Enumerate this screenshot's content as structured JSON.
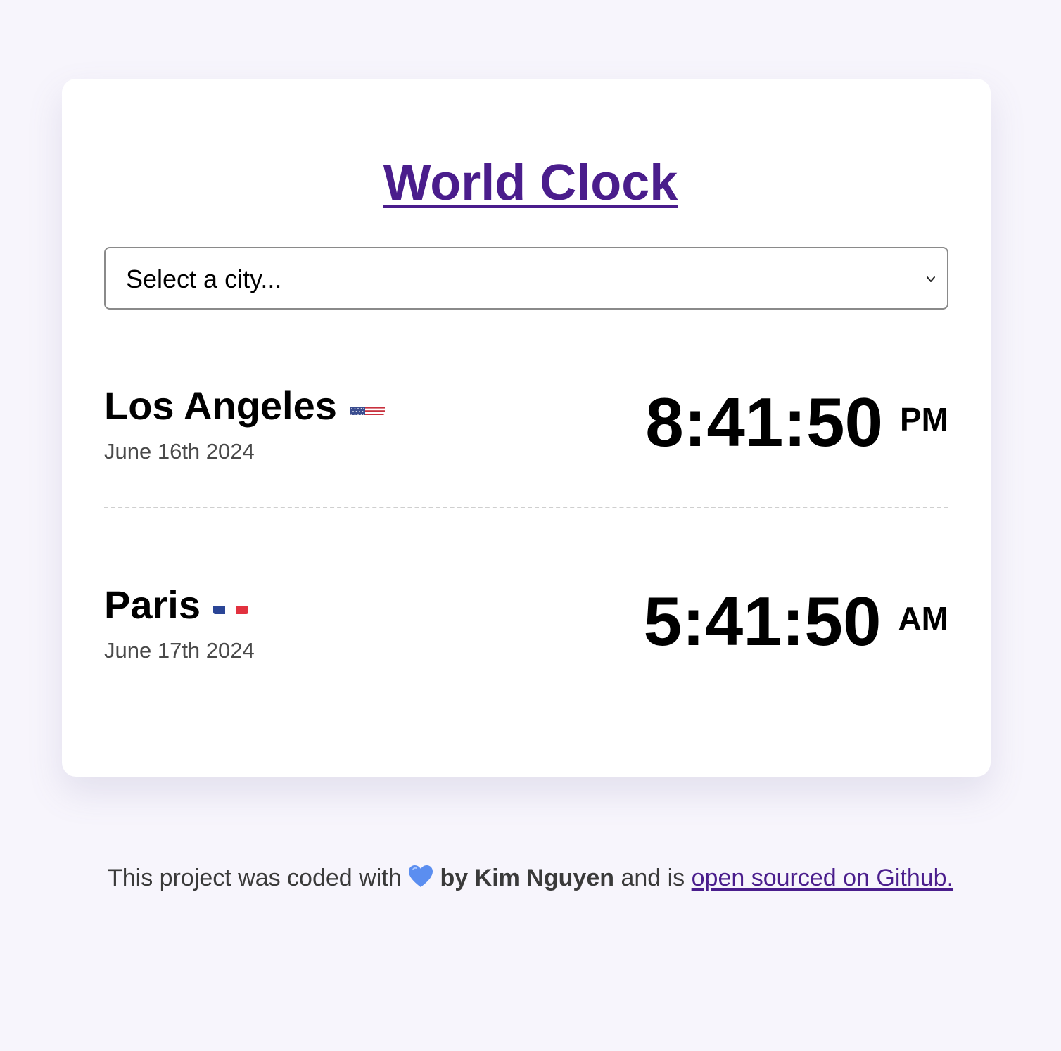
{
  "title": "World Clock",
  "city_select": {
    "value": "Select a city..."
  },
  "cities": [
    {
      "name": "Los Angeles",
      "flag_icon": "us-flag-icon",
      "date": "June 16th 2024",
      "time": "8:41:50",
      "ampm": "PM"
    },
    {
      "name": "Paris",
      "flag_icon": "fr-flag-icon",
      "date": "June 17th 2024",
      "time": "5:41:50",
      "ampm": "AM"
    }
  ],
  "footer": {
    "text_before": "This project was coded with",
    "heart_icon": "blue-heart-icon",
    "author": "by Kim Nguyen",
    "text_middle": "and is",
    "link_text": "open sourced on Github."
  },
  "colors": {
    "accent": "#4a1d8c",
    "background": "#f7f5fc",
    "card": "#ffffff",
    "heart": "#5b8ef0"
  }
}
